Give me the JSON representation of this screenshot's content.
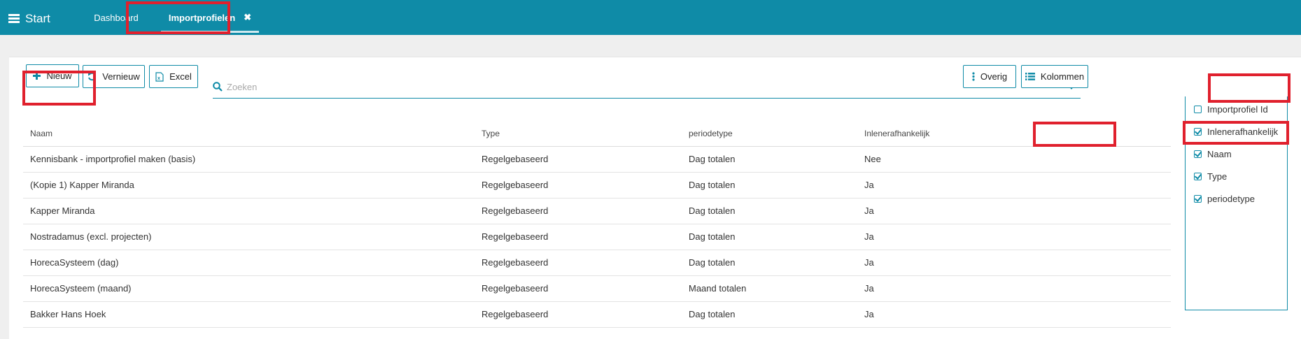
{
  "topbar": {
    "start_label": "Start",
    "tabs": [
      {
        "label": "Dashboard"
      },
      {
        "label": "Importprofielen",
        "close": "✖"
      }
    ]
  },
  "toolbar": {
    "new_label": "Nieuw",
    "refresh_label": "Vernieuw",
    "excel_label": "Excel",
    "search_placeholder": "Zoeken",
    "other_label": "Overig",
    "columns_label": "Kolommen"
  },
  "table": {
    "headers": [
      "Naam",
      "Type",
      "periodetype",
      "Inlenerafhankelijk"
    ],
    "rows": [
      [
        "Kennisbank - importprofiel maken (basis)",
        "Regelgebaseerd",
        "Dag totalen",
        "Nee"
      ],
      [
        "(Kopie 1) Kapper Miranda",
        "Regelgebaseerd",
        "Dag totalen",
        "Ja"
      ],
      [
        "Kapper Miranda",
        "Regelgebaseerd",
        "Dag totalen",
        "Ja"
      ],
      [
        "Nostradamus (excl. projecten)",
        "Regelgebaseerd",
        "Dag totalen",
        "Ja"
      ],
      [
        "HorecaSysteem (dag)",
        "Regelgebaseerd",
        "Dag totalen",
        "Ja"
      ],
      [
        "HorecaSysteem (maand)",
        "Regelgebaseerd",
        "Maand totalen",
        "Ja"
      ],
      [
        "Bakker Hans Hoek",
        "Regelgebaseerd",
        "Dag totalen",
        "Ja"
      ]
    ]
  },
  "columns_menu": {
    "items": [
      {
        "label": "Importprofiel Id",
        "checked": false
      },
      {
        "label": "Inlenerafhankelijk",
        "checked": true
      },
      {
        "label": "Naam",
        "checked": true
      },
      {
        "label": "Type",
        "checked": true
      },
      {
        "label": "periodetype",
        "checked": true
      }
    ]
  },
  "colors": {
    "brand": "#0f8ba7",
    "highlight": "#e0202d"
  }
}
